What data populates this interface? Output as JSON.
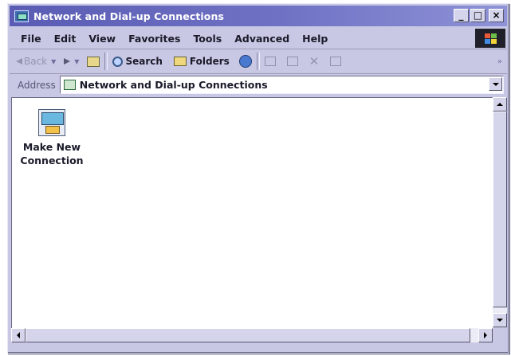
{
  "window": {
    "title": "Network and Dial-up Connections",
    "caption_buttons": {
      "minimize": "_",
      "maximize": "□",
      "close": "×"
    }
  },
  "menubar": {
    "items": [
      "File",
      "Edit",
      "View",
      "Favorites",
      "Tools",
      "Advanced",
      "Help"
    ]
  },
  "toolbar": {
    "back_label": "Back",
    "search_label": "Search",
    "folders_label": "Folders",
    "more": "»"
  },
  "addressbar": {
    "label": "Address",
    "value": "Network and Dial-up Connections"
  },
  "content": {
    "items": [
      {
        "label_line1": "Make New",
        "label_line2": "Connection",
        "icon": "make-new-connection-icon"
      }
    ]
  },
  "colors": {
    "title_gradient_start": "#5a5cb4",
    "title_gradient_end": "#8e92d6",
    "window_face": "#c8c8e4"
  }
}
